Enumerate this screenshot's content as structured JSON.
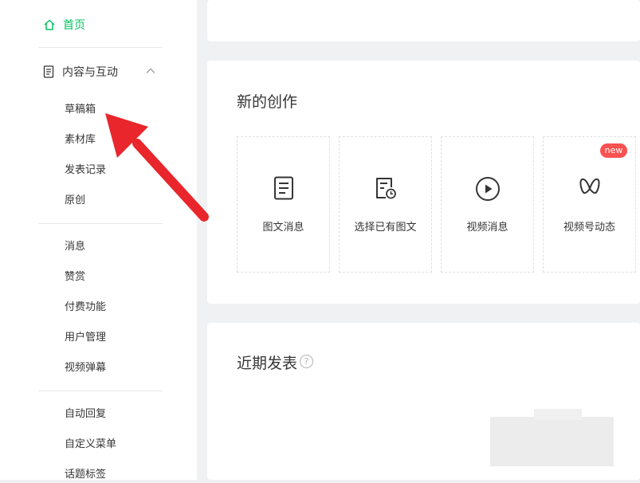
{
  "sidebar": {
    "home_label": "首页",
    "section_label": "内容与互动",
    "group1": [
      "草稿箱",
      "素材库",
      "发表记录",
      "原创"
    ],
    "group2": [
      "消息",
      "赞赏",
      "付费功能",
      "用户管理",
      "视频弹幕"
    ],
    "group3": [
      "自动回复",
      "自定义菜单",
      "话题标签"
    ]
  },
  "create": {
    "title": "新的创作",
    "tiles": [
      {
        "label": "图文消息",
        "icon": "document-icon"
      },
      {
        "label": "选择已有图文",
        "icon": "document-clock-icon"
      },
      {
        "label": "视频消息",
        "icon": "play-circle-icon"
      },
      {
        "label": "视频号动态",
        "icon": "channels-icon"
      }
    ],
    "badge": "new"
  },
  "recent": {
    "title": "近期发表",
    "help": "?"
  },
  "colors": {
    "accent": "#07c160",
    "badge": "#fa5151",
    "arrow": "#e8262b",
    "background": "#f0f1f3"
  }
}
